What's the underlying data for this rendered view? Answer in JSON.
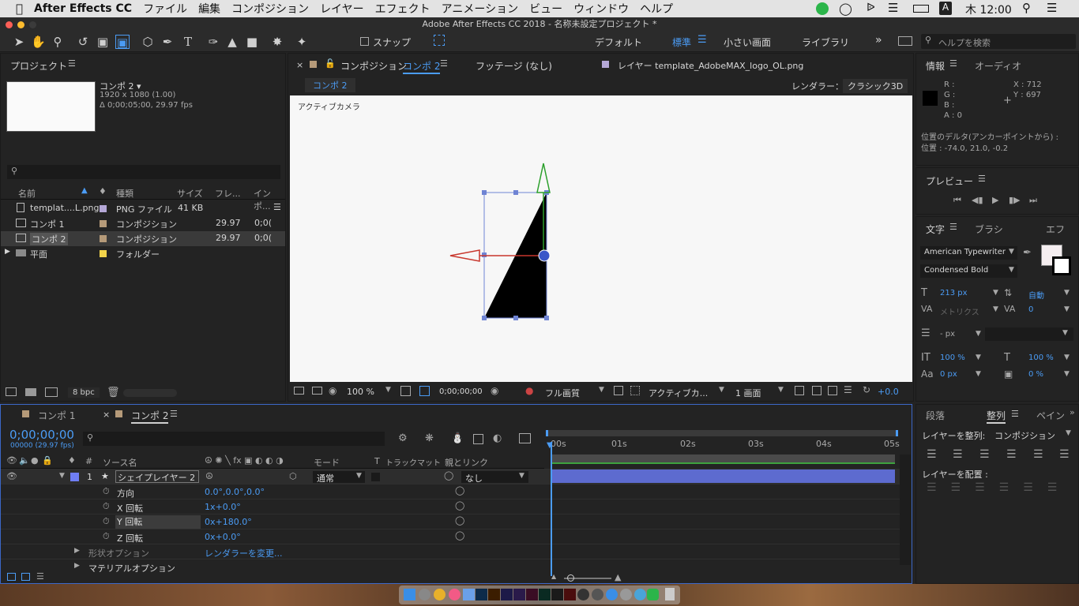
{
  "menubar": {
    "items": [
      "After Effects CC",
      "ファイル",
      "編集",
      "コンポジション",
      "レイヤー",
      "エフェクト",
      "アニメーション",
      "ビュー",
      "ウィンドウ",
      "ヘルプ"
    ],
    "clock": "木 12:00",
    "input_badge": "A"
  },
  "titlebar": {
    "title": "Adobe After Effects CC 2018 - 名称未設定プロジェクト *"
  },
  "toolbar": {
    "snap_label": "スナップ",
    "workspaces": [
      "デフォルト",
      "標準",
      "小さい画面",
      "ライブラリ"
    ],
    "help_placeholder": "ヘルプを検索"
  },
  "project": {
    "title": "プロジェクト",
    "comp_name": "コンポ 2 ▾",
    "comp_size": "1920 x 1080 (1.00)",
    "comp_duration": "Δ 0;00;05;00, 29.97 fps",
    "search_placeholder": "",
    "columns": [
      "名前",
      "種類",
      "サイズ",
      "フレ...",
      "インポ..."
    ],
    "rows": [
      {
        "name": "templat....L.png",
        "type": "PNG ファイル",
        "size": "41 KB",
        "fps": "",
        "imp": ""
      },
      {
        "name": "コンポ 1",
        "type": "コンポジション",
        "size": "",
        "fps": "29.97",
        "imp": "0;0("
      },
      {
        "name": "コンポ 2",
        "type": "コンポジション",
        "size": "",
        "fps": "29.97",
        "imp": "0;0("
      },
      {
        "name": "平面",
        "type": "フォルダー",
        "size": "",
        "fps": "",
        "imp": ""
      }
    ],
    "bpc": "8 bpc"
  },
  "viewer": {
    "tab_comp_label": "コンポジション",
    "tab_comp_name": "コンポ 2",
    "tab_footage": "フッテージ (なし)",
    "tab_layer": "レイヤー template_AdobeMAX_logo_OL.png",
    "subtab": "コンポ 2",
    "renderer_label": "レンダラー：",
    "renderer_value": "クラシック3D",
    "camera_label": "アクティブカメラ",
    "zoom": "100 %",
    "timecode": "0;00;00;00",
    "quality": "フル画質",
    "view": "アクティブカ...",
    "layout": "1 画面",
    "exposure": "+0.0"
  },
  "info": {
    "tab_info": "情報",
    "tab_audio": "オーディオ",
    "r": "R :",
    "g": "G :",
    "b": "B :",
    "a": "A : 0",
    "x": "X : 712",
    "y": "Y : 697",
    "delta_line1": "位置のデルタ(アンカーポイントから) :",
    "delta_line2": "位置 : -74.0, 21.0, -0.2"
  },
  "preview": {
    "title": "プレビュー"
  },
  "character": {
    "tab_text": "文字",
    "tab_brush": "ブラシ",
    "tab_effects": "エフ",
    "font": "American Typewriter",
    "style": "Condensed Bold",
    "size": "213 px",
    "leading": "自動",
    "kerning": "メトリクス",
    "tracking": "0",
    "stroke": "- px",
    "vscale": "100 %",
    "hscale": "100 %",
    "baseline": "0 px",
    "tsume": "0 %"
  },
  "timeline": {
    "tab1": "コンポ 1",
    "tab2": "コンポ 2",
    "timecode": "0;00;00;00",
    "timecode_sub": "00000 (29.97 fps)",
    "col_source": "ソース名",
    "col_mode": "モード",
    "col_t": "T",
    "col_trkmat": "トラックマット",
    "col_parent": "親とリンク",
    "layer": {
      "num": "1",
      "name": "シェイプレイヤー 2",
      "mode": "通常",
      "parent": "なし"
    },
    "props": [
      {
        "name": "方向",
        "value": "0.0°,0.0°,0.0°"
      },
      {
        "name": "X 回転",
        "value": "1x+0.0°"
      },
      {
        "name": "Y 回転",
        "value": "0x+180.0°"
      },
      {
        "name": "Z 回転",
        "value": "0x+0.0°"
      }
    ],
    "groups": [
      {
        "name": "形状オプション",
        "value": "レンダラーを変更..."
      },
      {
        "name": "マテリアルオプション",
        "value": ""
      }
    ],
    "ruler": [
      "00s",
      "01s",
      "02s",
      "03s",
      "04s",
      "05s"
    ]
  },
  "align": {
    "tab_para": "段落",
    "tab_align": "整列",
    "tab_paint": "ペイン",
    "align_to_label": "レイヤーを整列:",
    "align_to_value": "コンポジション",
    "distribute_label": "レイヤーを配置 :"
  }
}
